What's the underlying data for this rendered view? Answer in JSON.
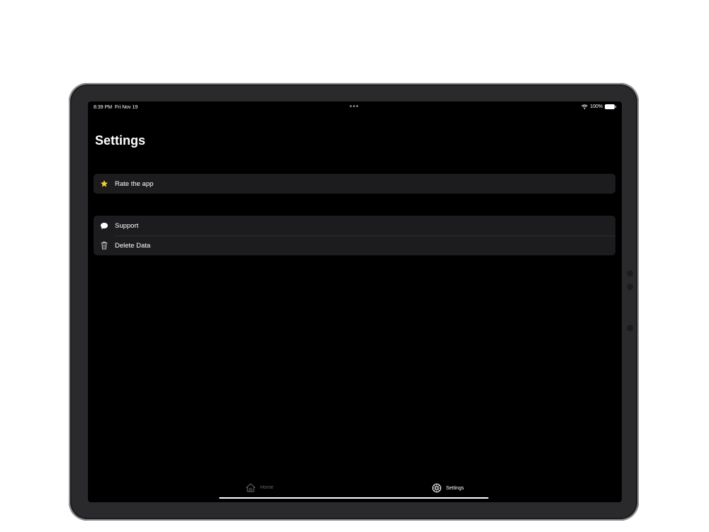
{
  "status_bar": {
    "time": "8:39 PM",
    "date": "Fri Nov 19",
    "multitask_dots": "•••",
    "battery_percent": "100%"
  },
  "page": {
    "title": "Settings"
  },
  "groups": [
    {
      "rows": [
        {
          "label": "Rate the app",
          "icon": "star-icon",
          "icon_color": "#f6d31f"
        }
      ]
    },
    {
      "rows": [
        {
          "label": "Support",
          "icon": "speech-bubble-icon",
          "icon_color": "#ffffff"
        },
        {
          "label": "Delete Data",
          "icon": "trash-icon",
          "icon_color": "#8e8e93"
        }
      ]
    }
  ],
  "tab_bar": {
    "tabs": [
      {
        "label": "Home",
        "icon": "house-icon",
        "selected": false,
        "color": "#636366"
      },
      {
        "label": "Settings",
        "icon": "gear-icon",
        "selected": true,
        "color": "#ffffff"
      }
    ]
  }
}
